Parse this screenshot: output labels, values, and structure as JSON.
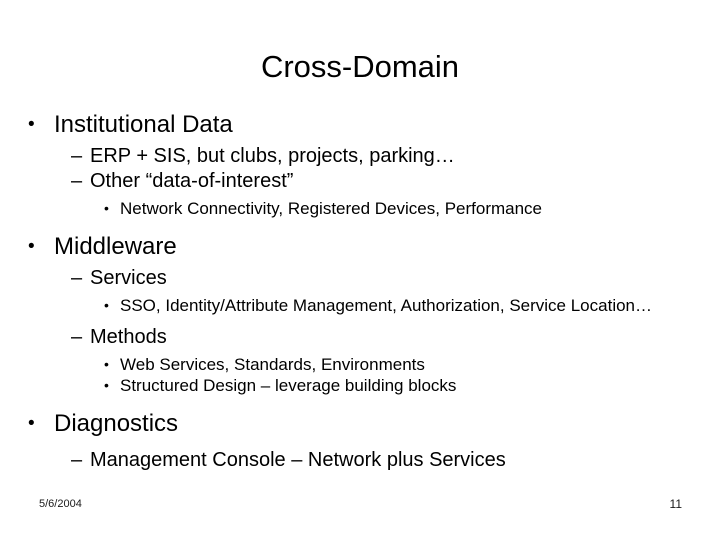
{
  "slide": {
    "title": "Cross-Domain",
    "date": "5/6/2004",
    "page_number": "11",
    "text_color": "#000000",
    "background_color": "#ffffff",
    "bullet_markers": {
      "level1": "•",
      "level2": "–",
      "level3": "•"
    },
    "content": [
      {
        "level": 1,
        "text": "Institutional Data"
      },
      {
        "level": 2,
        "text": "ERP + SIS, but clubs, projects, parking…"
      },
      {
        "level": 2,
        "text": "Other “data-of-interest”"
      },
      {
        "level": 3,
        "text": "Network Connectivity, Registered Devices, Performance"
      },
      {
        "level": 1,
        "text": "Middleware"
      },
      {
        "level": 2,
        "text": "Services"
      },
      {
        "level": 3,
        "text": "SSO, Identity/Attribute Management, Authorization, Service Location…"
      },
      {
        "level": 2,
        "text": "Methods"
      },
      {
        "level": 3,
        "text": "Web Services, Standards, Environments"
      },
      {
        "level": 3,
        "text": "Structured Design – leverage building blocks"
      },
      {
        "level": 1,
        "text": "Diagnostics"
      },
      {
        "level": 2,
        "text": "Management Console – Network plus Services"
      }
    ]
  }
}
